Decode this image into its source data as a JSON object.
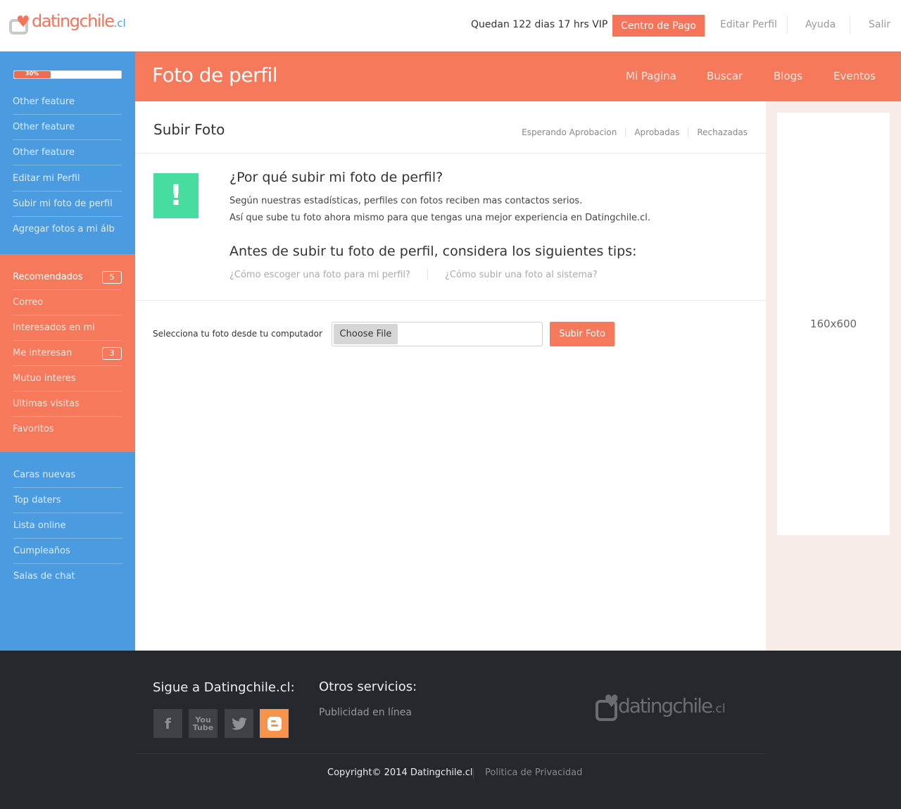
{
  "header": {
    "logo_text": "datingchile",
    "logo_domain": ".cl",
    "vip_status": "Quedan 122 dias 17 hrs VIP",
    "pay_button": "Centro de Pago",
    "links": [
      "Editar Perfil",
      "Ayuda",
      "Salir"
    ]
  },
  "sidebar": {
    "progress_label": "30%",
    "progress_value": 0.3,
    "profile_items": [
      "Other feature",
      "Other feature",
      "Other feature",
      "Editar mi Perfil",
      "Subir mi foto de perfil",
      "Agregar fotos a mi álb"
    ],
    "activity_items": [
      {
        "label": "Recomendados",
        "badge": "5"
      },
      {
        "label": "Correo",
        "badge": ""
      },
      {
        "label": "Interesados en mi",
        "badge": ""
      },
      {
        "label": "Me interesan",
        "badge": "3"
      },
      {
        "label": "Mutuo interes",
        "badge": ""
      },
      {
        "label": "Ultimas visitas",
        "badge": ""
      },
      {
        "label": "Favoritos",
        "badge": ""
      }
    ],
    "browse_items": [
      "Caras nuevas",
      "Top daters",
      "Lista online",
      "Cumpleaños",
      "Salas de chat"
    ]
  },
  "page": {
    "title": "Foto de perfil",
    "nav": [
      "Mi Pagina",
      "Buscar",
      "Blogs",
      "Eventos"
    ]
  },
  "main": {
    "section_title": "Subir Foto",
    "subtabs": [
      "Esperando Aprobacion",
      "Aprobadas",
      "Rechazadas"
    ],
    "alert_symbol": "!",
    "why_title": "¿Por qué subir mi foto de perfil?",
    "why_text_1": "Según nuestras estadísticas, perfiles con fotos reciben mas contactos serios.",
    "why_text_2": "Así que sube tu foto ahora mismo para que tengas una mejor experiencia en Datingchile.cl.",
    "tips_title": "Antes de subir tu foto de perfil, considera los siguientes tips:",
    "tip_links": [
      "¿Cómo escoger una foto para mi perfil?",
      "¿Cómo subir una foto al sistema?"
    ],
    "upload_label": "Selecciona tu foto desde tu computador",
    "choose_file": "Choose File",
    "upload_button": "Subir Foto"
  },
  "ad": {
    "size_label": "160x600"
  },
  "footer": {
    "follow_title": "Sigue a Datingchile.cl:",
    "social_icons": [
      "facebook-icon",
      "youtube-icon",
      "twitter-icon",
      "blogger-icon"
    ],
    "services_title": "Otros servicios:",
    "services_link": "Publicidad en línea",
    "logo_text": "datingchile",
    "logo_domain": ".cl",
    "copyright": "Copyright© 2014  Datingchile.cl",
    "privacy": "Politica de Privacidad"
  },
  "colors": {
    "accent": "#f6795c",
    "sidebar_blue": "#4a9be0",
    "alert_green": "#48dda0",
    "footer_bg": "#25292e",
    "blogger_orange": "#f7934a"
  }
}
